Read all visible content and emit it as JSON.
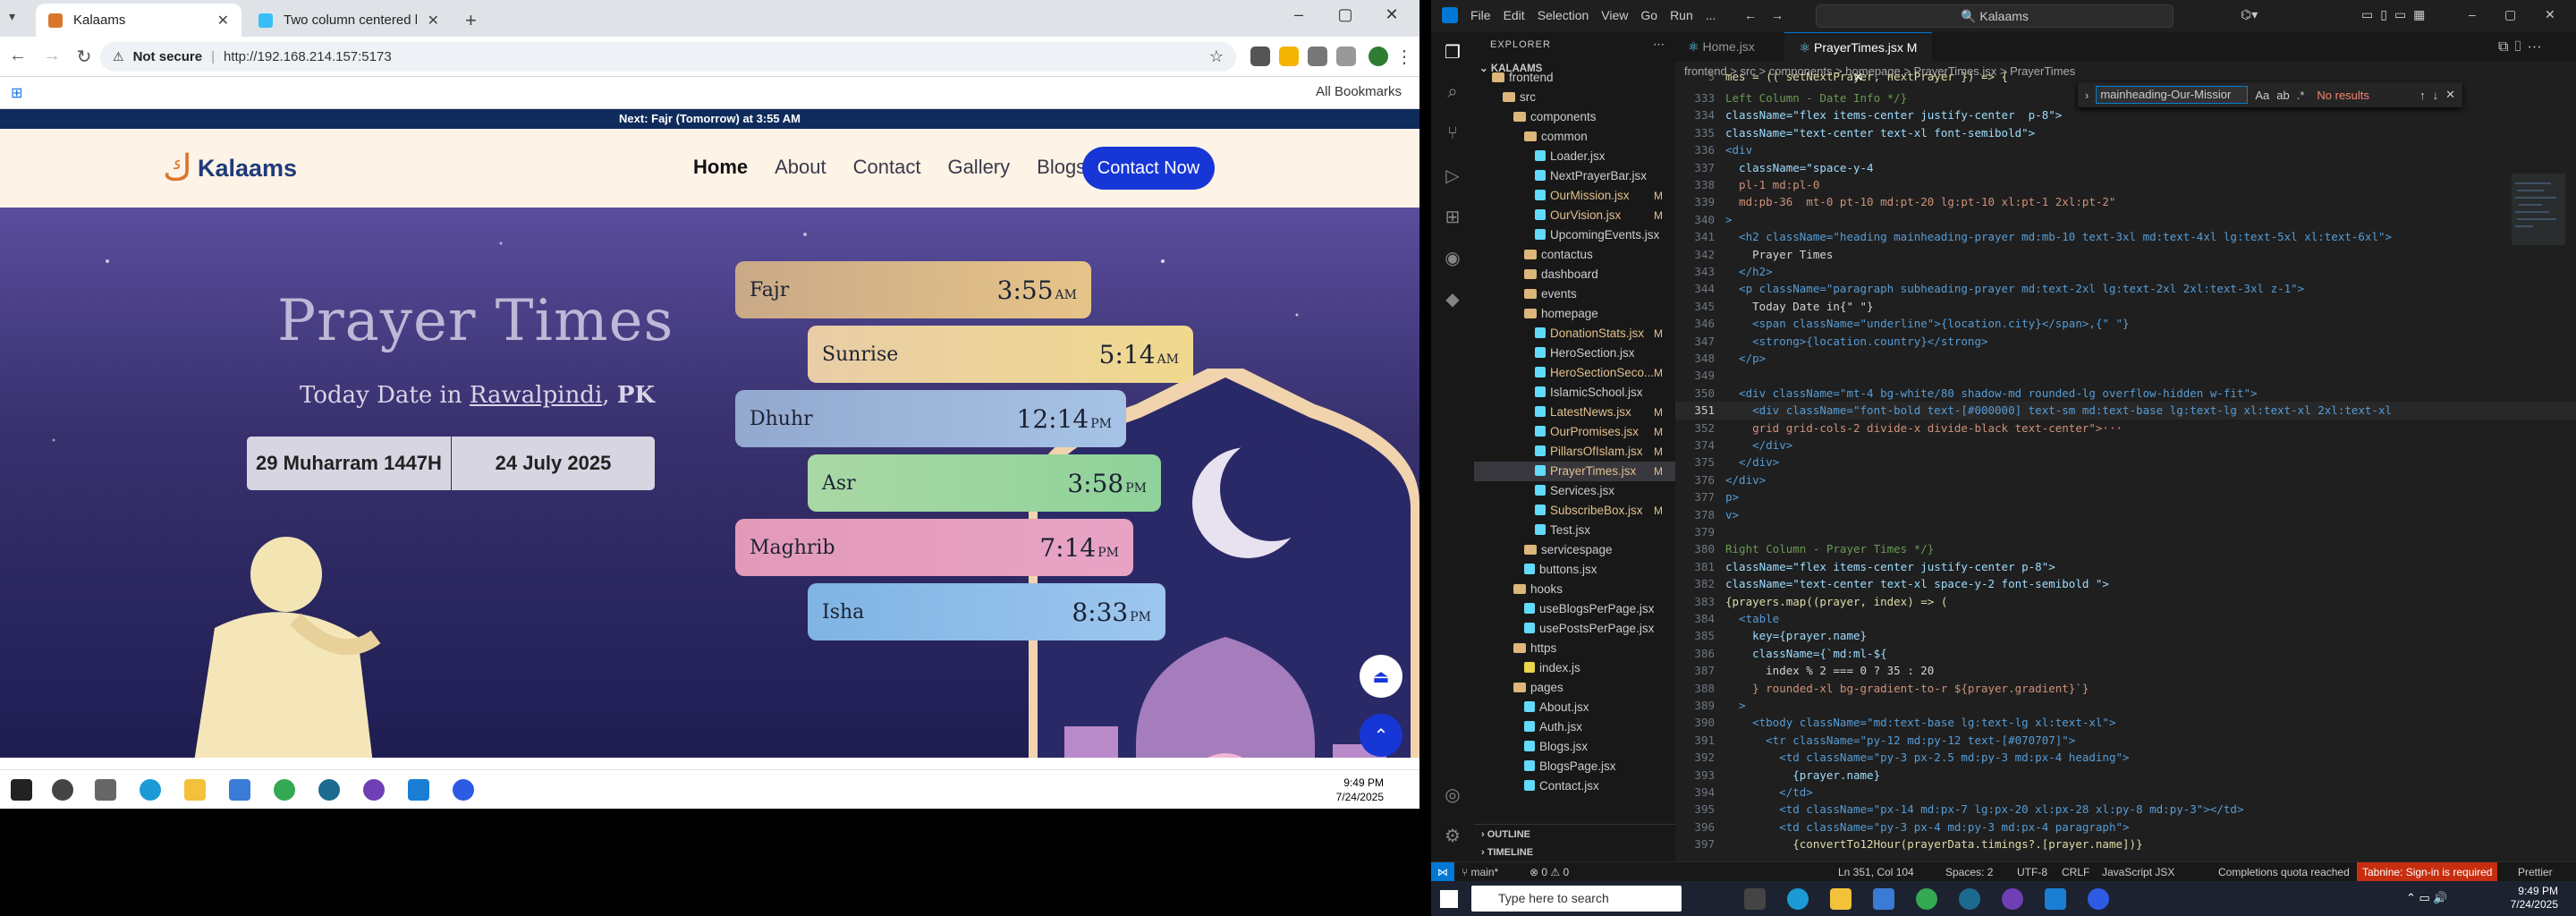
{
  "chrome": {
    "tabs": [
      {
        "label": "Kalaams"
      },
      {
        "label": "Two column centered layout"
      }
    ],
    "security_label": "Not secure",
    "url": "http://192.168.214.157:5173",
    "bookmarks_label": "All Bookmarks"
  },
  "site": {
    "next_prayer_text": "Next: Fajr (Tomorrow) at 3:55 AM",
    "logo_text": "Kalaams",
    "nav": [
      "Home",
      "About",
      "Contact",
      "Gallery",
      "Blogs"
    ],
    "cta": "Contact Now",
    "heading": "Prayer Times",
    "date_prefix": "Today Date in ",
    "city": "Rawalpindi",
    "country": "PK",
    "hijri_date": "29 Muharram 1447H",
    "greg_date": "24 July 2025",
    "prayers": [
      {
        "name": "Fajr",
        "time": "3:55",
        "ampm": "AM"
      },
      {
        "name": "Sunrise",
        "time": "5:14",
        "ampm": "AM"
      },
      {
        "name": "Dhuhr",
        "time": "12:14",
        "ampm": "PM"
      },
      {
        "name": "Asr",
        "time": "3:58",
        "ampm": "PM"
      },
      {
        "name": "Maghrib",
        "time": "7:14",
        "ampm": "PM"
      },
      {
        "name": "Isha",
        "time": "8:33",
        "ampm": "PM"
      }
    ]
  },
  "left_taskbar": {
    "time": "9:49 PM",
    "date": "7/24/2025"
  },
  "vscode": {
    "menu": [
      "File",
      "Edit",
      "Selection",
      "View",
      "Go",
      "Run",
      "..."
    ],
    "search": "Kalaams",
    "explorer_title": "EXPLORER",
    "project": "KALAAMS",
    "tree": [
      {
        "label": "frontend",
        "kind": "folder",
        "depth": 1,
        "mod": ""
      },
      {
        "label": "src",
        "kind": "folder",
        "depth": 2,
        "mod": ""
      },
      {
        "label": "components",
        "kind": "folder",
        "depth": 3,
        "mod": ""
      },
      {
        "label": "common",
        "kind": "folder",
        "depth": 4,
        "mod": ""
      },
      {
        "label": "Loader.jsx",
        "kind": "file",
        "depth": 5,
        "mod": ""
      },
      {
        "label": "NextPrayerBar.jsx",
        "kind": "file",
        "depth": 5,
        "mod": ""
      },
      {
        "label": "OurMission.jsx",
        "kind": "file",
        "depth": 5,
        "mod": "M"
      },
      {
        "label": "OurVision.jsx",
        "kind": "file",
        "depth": 5,
        "mod": "M"
      },
      {
        "label": "UpcomingEvents.jsx",
        "kind": "file",
        "depth": 5,
        "mod": ""
      },
      {
        "label": "contactus",
        "kind": "folder",
        "depth": 4,
        "mod": ""
      },
      {
        "label": "dashboard",
        "kind": "folder",
        "depth": 4,
        "mod": ""
      },
      {
        "label": "events",
        "kind": "folder",
        "depth": 4,
        "mod": ""
      },
      {
        "label": "homepage",
        "kind": "folder",
        "depth": 4,
        "mod": ""
      },
      {
        "label": "DonationStats.jsx",
        "kind": "file",
        "depth": 5,
        "mod": "M"
      },
      {
        "label": "HeroSection.jsx",
        "kind": "file",
        "depth": 5,
        "mod": ""
      },
      {
        "label": "HeroSectionSeco...",
        "kind": "file",
        "depth": 5,
        "mod": "M"
      },
      {
        "label": "IslamicSchool.jsx",
        "kind": "file",
        "depth": 5,
        "mod": ""
      },
      {
        "label": "LatestNews.jsx",
        "kind": "file",
        "depth": 5,
        "mod": "M"
      },
      {
        "label": "OurPromises.jsx",
        "kind": "file",
        "depth": 5,
        "mod": "M"
      },
      {
        "label": "PillarsOfIslam.jsx",
        "kind": "file",
        "depth": 5,
        "mod": "M"
      },
      {
        "label": "PrayerTimes.jsx",
        "kind": "file",
        "depth": 5,
        "mod": "M",
        "sel": true
      },
      {
        "label": "Services.jsx",
        "kind": "file",
        "depth": 5,
        "mod": ""
      },
      {
        "label": "SubscribeBox.jsx",
        "kind": "file",
        "depth": 5,
        "mod": "M"
      },
      {
        "label": "Test.jsx",
        "kind": "file",
        "depth": 5,
        "mod": ""
      },
      {
        "label": "servicespage",
        "kind": "folder",
        "depth": 4,
        "mod": ""
      },
      {
        "label": "buttons.jsx",
        "kind": "file",
        "depth": 4,
        "mod": ""
      },
      {
        "label": "hooks",
        "kind": "folder",
        "depth": 3,
        "mod": ""
      },
      {
        "label": "useBlogsPerPage.jsx",
        "kind": "file",
        "depth": 4,
        "mod": ""
      },
      {
        "label": "usePostsPerPage.jsx",
        "kind": "file",
        "depth": 4,
        "mod": ""
      },
      {
        "label": "https",
        "kind": "folder",
        "depth": 3,
        "mod": ""
      },
      {
        "label": "index.js",
        "kind": "file",
        "depth": 4,
        "mod": ""
      },
      {
        "label": "pages",
        "kind": "folder",
        "depth": 3,
        "mod": ""
      },
      {
        "label": "About.jsx",
        "kind": "file",
        "depth": 4,
        "mod": ""
      },
      {
        "label": "Auth.jsx",
        "kind": "file",
        "depth": 4,
        "mod": ""
      },
      {
        "label": "Blogs.jsx",
        "kind": "file",
        "depth": 4,
        "mod": ""
      },
      {
        "label": "BlogsPage.jsx",
        "kind": "file",
        "depth": 4,
        "mod": ""
      },
      {
        "label": "Contact.jsx",
        "kind": "file",
        "depth": 4,
        "mod": ""
      }
    ],
    "outline": "OUTLINE",
    "timeline": "TIMELINE",
    "editor_tabs": [
      {
        "label": "Home.jsx"
      },
      {
        "label": "PrayerTimes.jsx M"
      }
    ],
    "breadcrumb": "frontend > src > components > homepage > PrayerTimes.jsx > PrayerTimes",
    "find_text": "mainheading-Our-Missior",
    "find_result": "No results",
    "code_header": "mes = (( setNextPrayer, nextPrayer }) => {",
    "code_header_no": "5",
    "code": [
      {
        "no": "333",
        "text": "Left Column - Date Info */}",
        "cls": "c-cm"
      },
      {
        "no": "334",
        "text": "className=\"flex items-center justify-center  p-8\">",
        "cls": "c-at"
      },
      {
        "no": "335",
        "text": "className=\"text-center text-xl font-semibold\">",
        "cls": "c-at"
      },
      {
        "no": "336",
        "text": "<div",
        "cls": "c-tg"
      },
      {
        "no": "337",
        "text": "  className=\"space-y-4",
        "cls": "c-at"
      },
      {
        "no": "338",
        "text": "  pl-1 md:pl-0",
        "cls": "c-st"
      },
      {
        "no": "339",
        "text": "  md:pb-36  mt-0 pt-10 md:pt-20 lg:pt-10 xl:pt-1 2xl:pt-2\"",
        "cls": "c-st"
      },
      {
        "no": "340",
        "text": ">",
        "cls": "c-tg"
      },
      {
        "no": "341",
        "text": "  <h2 className=\"heading mainheading-prayer md:mb-10 text-3xl md:text-4xl lg:text-5xl xl:text-6xl\">",
        "cls": "c-tg"
      },
      {
        "no": "342",
        "text": "    Prayer Times",
        "cls": "c-tx"
      },
      {
        "no": "343",
        "text": "  </h2>",
        "cls": "c-tg"
      },
      {
        "no": "344",
        "text": "  <p className=\"paragraph subheading-prayer md:text-2xl lg:text-2xl 2xl:text-3xl z-1\">",
        "cls": "c-tg"
      },
      {
        "no": "345",
        "text": "    Today Date in{\" \"}",
        "cls": "c-tx"
      },
      {
        "no": "346",
        "text": "    <span className=\"underline\">{location.city}</span>,{\" \"}",
        "cls": "c-tg"
      },
      {
        "no": "347",
        "text": "    <strong>{location.country}</strong>",
        "cls": "c-tg"
      },
      {
        "no": "348",
        "text": "  </p>",
        "cls": "c-tg"
      },
      {
        "no": "349",
        "text": "",
        "cls": "c-tx"
      },
      {
        "no": "350",
        "text": "  <div className=\"mt-4 bg-white/80 shadow-md rounded-lg overflow-hidden w-fit\">",
        "cls": "c-tg"
      },
      {
        "no": "351",
        "text": "    <div className=\"font-bold text-[#000000] text-sm md:text-base lg:text-lg xl:text-xl 2xl:text-xl",
        "cls": "c-tg",
        "cur": true
      },
      {
        "no": "352",
        "text": "    grid grid-cols-2 divide-x divide-black text-center\">···",
        "cls": "c-st"
      },
      {
        "no": "374",
        "text": "    </div>",
        "cls": "c-tg"
      },
      {
        "no": "375",
        "text": "  </div>",
        "cls": "c-tg"
      },
      {
        "no": "376",
        "text": "</div>",
        "cls": "c-tg"
      },
      {
        "no": "377",
        "text": "p>",
        "cls": "c-tg"
      },
      {
        "no": "378",
        "text": "v>",
        "cls": "c-tg"
      },
      {
        "no": "379",
        "text": "",
        "cls": "c-tx"
      },
      {
        "no": "380",
        "text": "Right Column - Prayer Times */}",
        "cls": "c-cm"
      },
      {
        "no": "381",
        "text": "className=\"flex items-center justify-center p-8\">",
        "cls": "c-at"
      },
      {
        "no": "382",
        "text": "className=\"text-center text-xl space-y-2 font-semibold \">",
        "cls": "c-at"
      },
      {
        "no": "383",
        "text": "{prayers.map((prayer, index) => (",
        "cls": "c-fn"
      },
      {
        "no": "384",
        "text": "  <table",
        "cls": "c-tg"
      },
      {
        "no": "385",
        "text": "    key={prayer.name}",
        "cls": "c-at"
      },
      {
        "no": "386",
        "text": "    className={`md:ml-${",
        "cls": "c-at"
      },
      {
        "no": "387",
        "text": "      index % 2 === 0 ? 35 : 20",
        "cls": "c-tx"
      },
      {
        "no": "388",
        "text": "    } rounded-xl bg-gradient-to-r ${prayer.gradient}`}",
        "cls": "c-st"
      },
      {
        "no": "389",
        "text": "  >",
        "cls": "c-tg"
      },
      {
        "no": "390",
        "text": "    <tbody className=\"md:text-base lg:text-lg xl:text-xl\">",
        "cls": "c-tg"
      },
      {
        "no": "391",
        "text": "      <tr className=\"py-12 md:py-12 text-[#070707]\">",
        "cls": "c-tg"
      },
      {
        "no": "392",
        "text": "        <td className=\"py-3 px-2.5 md:py-3 md:px-4 heading\">",
        "cls": "c-tg"
      },
      {
        "no": "393",
        "text": "          {prayer.name}",
        "cls": "c-at"
      },
      {
        "no": "394",
        "text": "        </td>",
        "cls": "c-tg"
      },
      {
        "no": "395",
        "text": "        <td className=\"px-14 md:px-7 lg:px-20 xl:px-28 xl:py-8 md:py-3\"></td>",
        "cls": "c-tg"
      },
      {
        "no": "396",
        "text": "        <td className=\"py-3 px-4 md:py-3 md:px-4 paragraph\">",
        "cls": "c-tg"
      },
      {
        "no": "397",
        "text": "          {convertTo12Hour(prayerData.timings?.[prayer.name])}",
        "cls": "c-fn"
      }
    ],
    "status": {
      "branch": "main*",
      "problems": "0 ⚠ 0",
      "cursor": "Ln 351, Col 104",
      "spaces": "Spaces: 2",
      "enc": "UTF-8",
      "eol": "CRLF",
      "lang": "JavaScript JSX",
      "quota": "Completions quota reached",
      "tabnine": "Tabnine: Sign-in is required",
      "prettier": "Prettier"
    }
  },
  "right_taskbar": {
    "search_placeholder": "Type here to search",
    "time": "9:49 PM",
    "date": "7/24/2025"
  }
}
